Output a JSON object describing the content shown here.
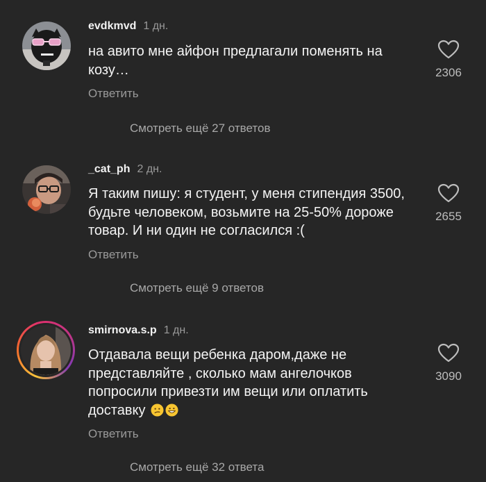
{
  "comments": [
    {
      "username": "evdkmvd",
      "time": "1 дн.",
      "text": "на авито мне айфон предлагали поменять на козу…",
      "likes": "2306",
      "reply_label": "Ответить",
      "more_replies": "Смотреть ещё 27 ответов",
      "avatar_icon": "avatar-pet-sunglasses"
    },
    {
      "username": "_cat_ph",
      "time": "2 дн.",
      "text": "Я таким пишу: я студент, у меня стипендия 3500, будьте человеком, возьмите на 25-50% дороже товар. И ни один не согласился :(",
      "likes": "2655",
      "reply_label": "Ответить",
      "more_replies": "Смотреть ещё 9 ответов",
      "avatar_icon": "avatar-person-glasses"
    },
    {
      "username": "smirnova.s.p",
      "time": "1 дн.",
      "text": "Отдавала вещи ребенка даром,даже не представляйте , сколько мам ангелочков попросили привезти им вещи или оплатить доставку",
      "emojis": [
        "confused-face-emoji",
        "grinning-face-emoji"
      ],
      "likes": "3090",
      "reply_label": "Ответить",
      "more_replies": "Смотреть ещё 32 ответа",
      "avatar_icon": "avatar-woman-story-ring"
    }
  ],
  "colors": {
    "background": "#262626",
    "primary_text": "#f4f4f4",
    "secondary_text": "#9a9a9a",
    "heart_outline": "#bdbdbd"
  }
}
